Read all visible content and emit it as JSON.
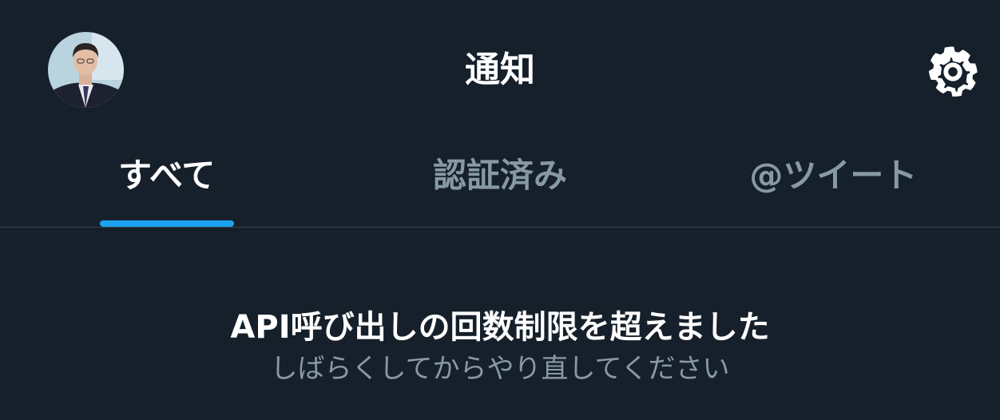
{
  "header": {
    "title": "通知",
    "avatar_icon": "profile-avatar",
    "settings_icon": "gear-icon"
  },
  "tabs": [
    {
      "label": "すべて",
      "active": true
    },
    {
      "label": "認証済み",
      "active": false
    },
    {
      "label": "@ツイート",
      "active": false
    }
  ],
  "message": {
    "title": "API呼び出しの回数制限を超えました",
    "subtitle": "しばらくしてからやり直してください"
  },
  "colors": {
    "background": "#15202b",
    "accent": "#1da1f2",
    "text_primary": "#ffffff",
    "text_secondary": "#8899a6",
    "divider": "#38444d"
  }
}
